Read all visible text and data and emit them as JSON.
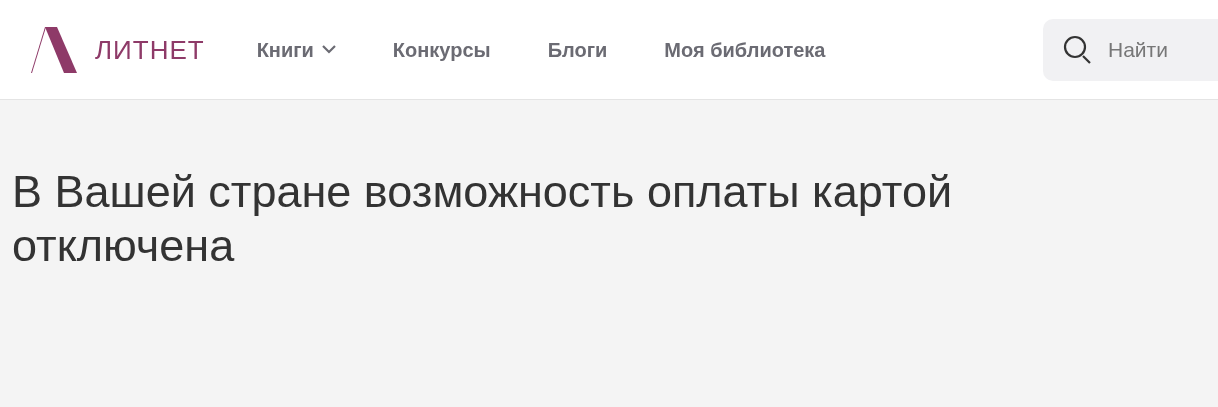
{
  "header": {
    "logo_text": "ЛИТНЕТ",
    "nav": [
      {
        "label": "Книги",
        "has_menu": true
      },
      {
        "label": "Конкурсы",
        "has_menu": false
      },
      {
        "label": "Блоги",
        "has_menu": false
      },
      {
        "label": "Моя библиотека",
        "has_menu": false
      }
    ],
    "search": {
      "placeholder": "Найти"
    }
  },
  "message": "В Вашей стране возможность оплаты картой отключена"
}
